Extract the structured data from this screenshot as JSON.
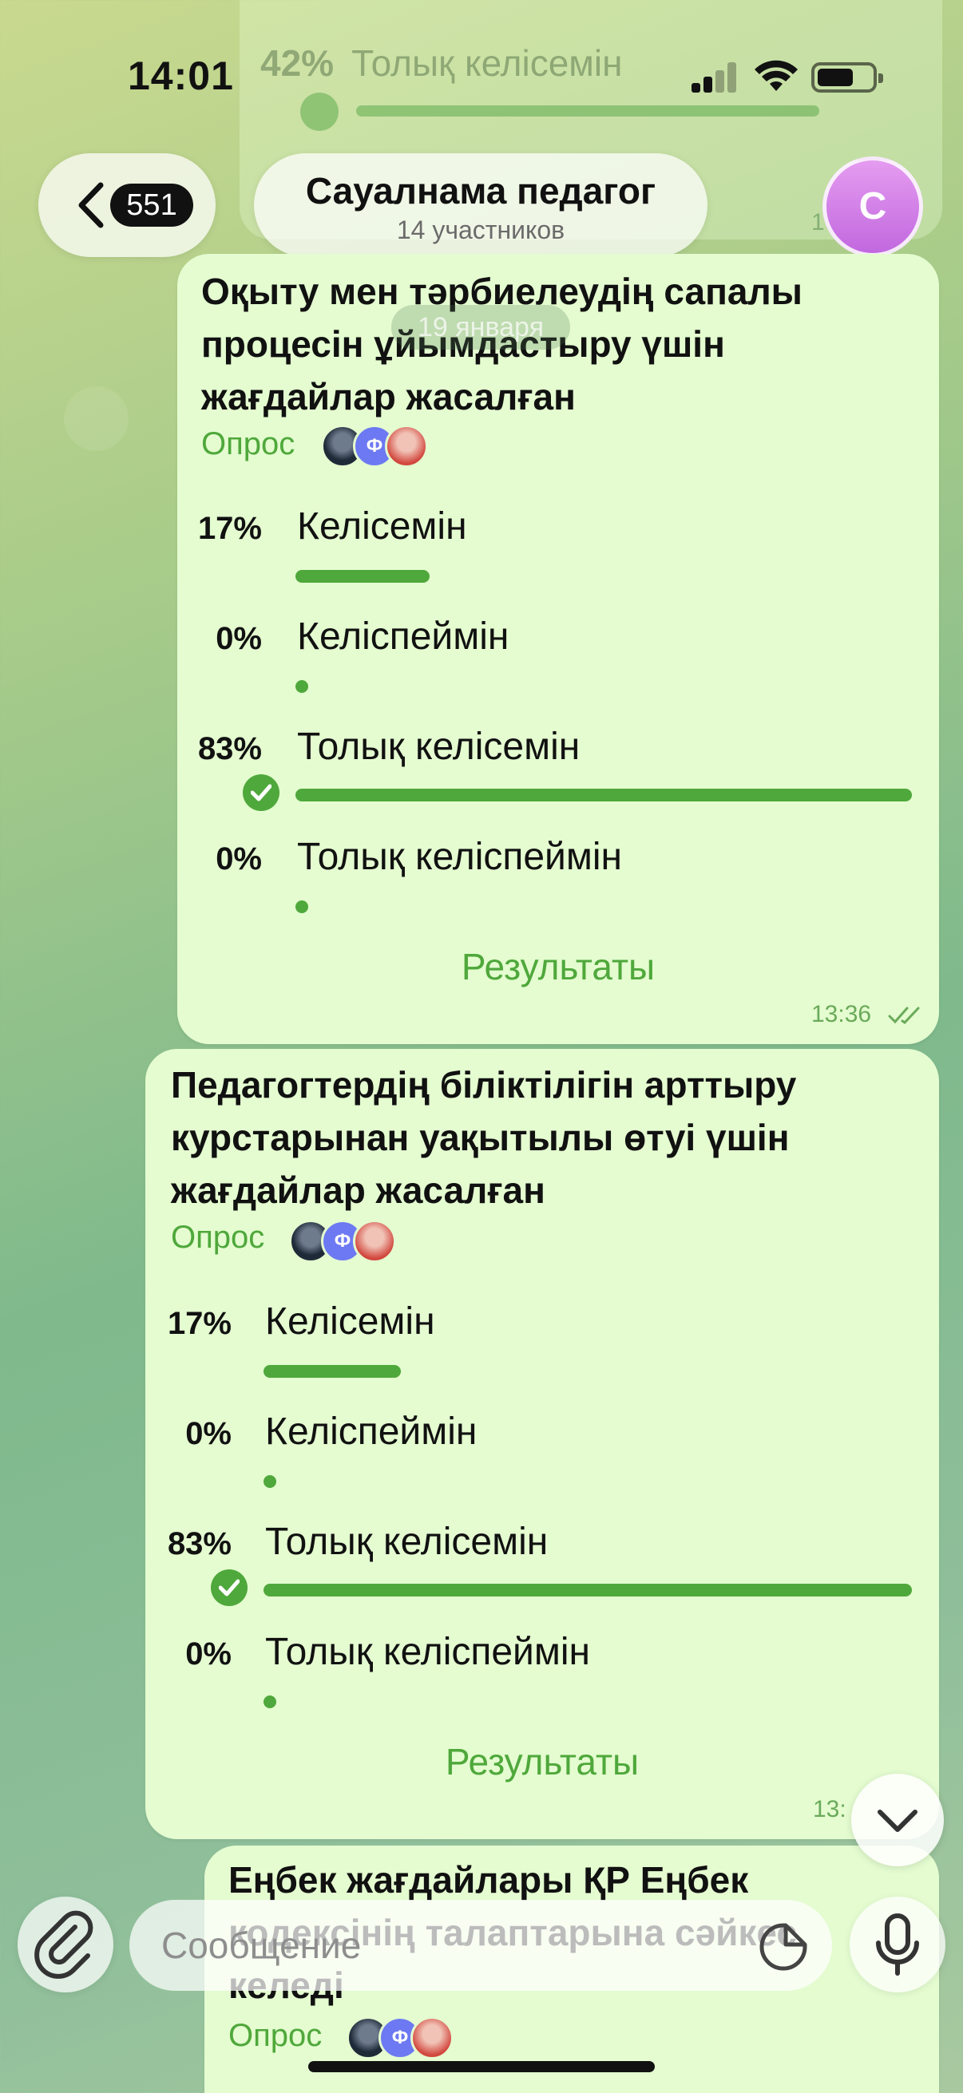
{
  "status_bar": {
    "time": "14:01"
  },
  "previous_message": {
    "option_percent": "42%",
    "option_label": "Толық келісемін",
    "time": "1"
  },
  "header": {
    "back_badge": "551",
    "title": "Сауалнама педагог",
    "subtitle": "14 участников",
    "avatar_letter": "С"
  },
  "date_separator": "19 января",
  "polls": [
    {
      "question": "Оқыту мен тәрбиелеудің сапалы процесін ұйымдастыру үшін жағдайлар жасалған",
      "type_label": "Опрос",
      "voter_badge": "Ф",
      "options": [
        {
          "percent": "17%",
          "label": "Келісемін",
          "share": 0.17
        },
        {
          "percent": "0%",
          "label": "Келіспеймін",
          "share": 0
        },
        {
          "percent": "83%",
          "label": "Толық келісемін",
          "share": 0.83,
          "selected": true
        },
        {
          "percent": "0%",
          "label": "Толық келіспеймін",
          "share": 0
        }
      ],
      "results_label": "Результаты",
      "time": "13:36"
    },
    {
      "question": "Педагогтердің біліктілігін арттыру курстарынан уақытылы өтуі үшін жағдайлар жасалған",
      "type_label": "Опрос",
      "voter_badge": "Ф",
      "options": [
        {
          "percent": "17%",
          "label": "Келісемін",
          "share": 0.17
        },
        {
          "percent": "0%",
          "label": "Келіспеймін",
          "share": 0
        },
        {
          "percent": "83%",
          "label": "Толық келісемін",
          "share": 0.83,
          "selected": true
        },
        {
          "percent": "0%",
          "label": "Толық келіспеймін",
          "share": 0
        }
      ],
      "results_label": "Результаты",
      "time": "13:"
    },
    {
      "question": "Еңбек жағдайлары ҚР Еңбек кодексінің талаптарына сәйкес келеді",
      "type_label": "Опрос",
      "voter_badge": "Ф"
    }
  ],
  "composer": {
    "placeholder": "Сообщение"
  },
  "colors": {
    "accent": "#4fa83b",
    "bubble": "#e4fcd0",
    "avatar": "#c168df"
  }
}
